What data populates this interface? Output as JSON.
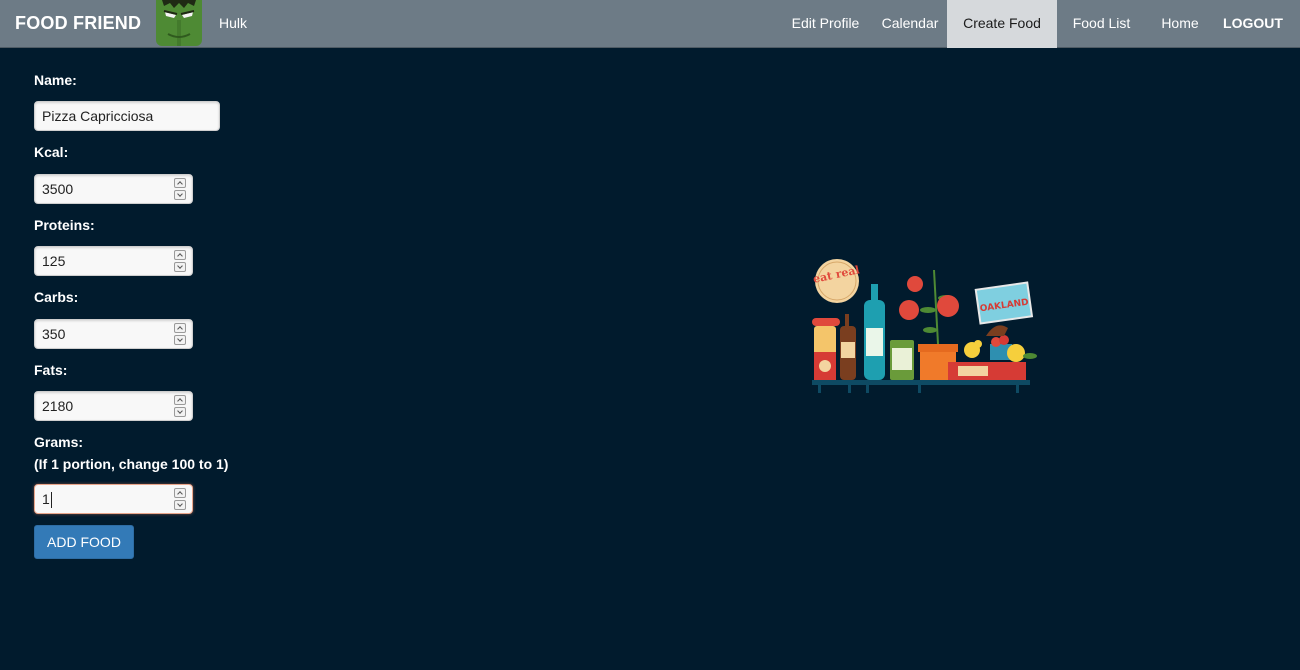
{
  "navbar": {
    "brand": "FOOD FRIEND",
    "username": "Hulk",
    "items": [
      {
        "label": "Edit Profile",
        "active": false
      },
      {
        "label": "Calendar",
        "active": false
      },
      {
        "label": "Create Food",
        "active": true
      },
      {
        "label": "Food List",
        "active": false
      },
      {
        "label": "Home",
        "active": false
      },
      {
        "label": "LOGOUT",
        "active": false
      }
    ]
  },
  "form": {
    "name_label": "Name:",
    "name_value": "Pizza Capricciosa",
    "kcal_label": "Kcal:",
    "kcal_value": "3500",
    "proteins_label": "Proteins:",
    "proteins_value": "125",
    "carbs_label": "Carbs:",
    "carbs_value": "350",
    "fats_label": "Fats:",
    "fats_value": "2180",
    "grams_label": "Grams:",
    "grams_hint": "(If 1 portion, change 100 to 1)",
    "grams_value": "1",
    "submit_label": "ADD FOOD"
  },
  "illustration": {
    "badge_text": "eat real",
    "sign_text": "OAKLAND"
  },
  "colors": {
    "background": "#011b2d",
    "navbar": "#6d7b86",
    "active_tab": "#d6d9dc",
    "button": "#337ab7"
  }
}
